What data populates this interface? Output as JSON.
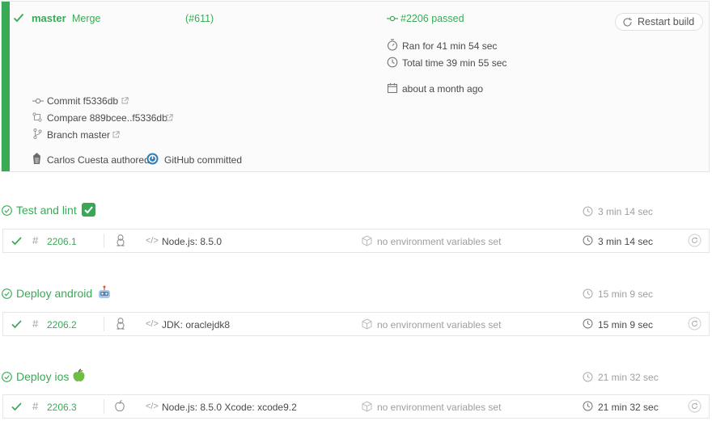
{
  "build": {
    "branch": "master",
    "message": "Merge",
    "pr": "(#611)",
    "status": "#2206 passed",
    "ran_for": "Ran for 41 min 54 sec",
    "total_time": "Total time 39 min 55 sec",
    "date": "about a month ago",
    "commit": "Commit f5336db",
    "compare": "Compare 889bcee..f5336db",
    "branch_link": "Branch master",
    "author": "Carlos Cuesta authored",
    "committer": "GitHub committed",
    "restart_label": "Restart build"
  },
  "stages": [
    {
      "name": "Test and lint",
      "emoji": "white-check-mark-icon",
      "duration": "3 min 14 sec",
      "job": {
        "number": "2206.1",
        "os": "linux-icon",
        "env": "Node.js: 8.5.0",
        "vars": "no environment variables set",
        "duration": "3 min 14 sec"
      }
    },
    {
      "name": "Deploy android",
      "emoji": "robot-icon",
      "duration": "15 min 9 sec",
      "job": {
        "number": "2206.2",
        "os": "linux-icon",
        "env": "JDK: oraclejdk8",
        "vars": "no environment variables set",
        "duration": "15 min 9 sec"
      }
    },
    {
      "name": "Deploy ios",
      "emoji": "green-apple-icon",
      "duration": "21 min 32 sec",
      "job": {
        "number": "2206.3",
        "os": "apple-icon",
        "env": "Node.js: 8.5.0 Xcode: xcode9.2",
        "vars": "no environment variables set",
        "duration": "21 min 32 sec"
      }
    }
  ],
  "colors": {
    "passed": "#39aa56",
    "muted": "#9e9e9e",
    "border": "#e6e6e6"
  }
}
